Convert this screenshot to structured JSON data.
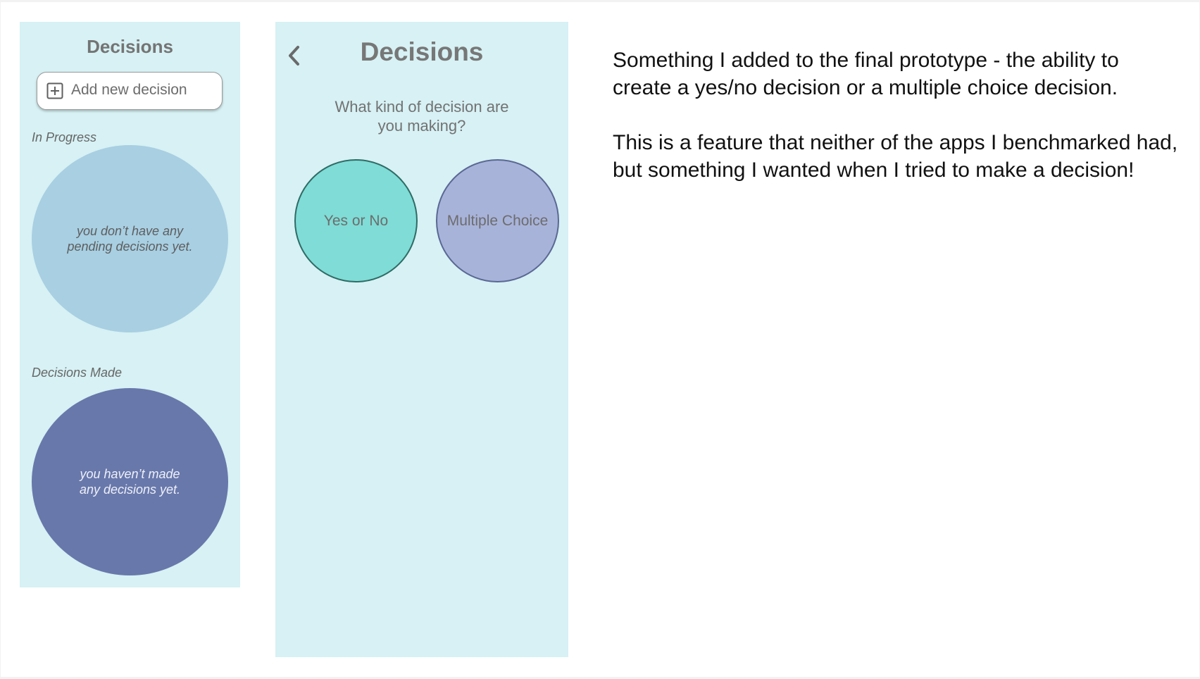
{
  "screen1": {
    "title": "Decisions",
    "add_button_label": "Add new decision",
    "in_progress_label": "In Progress",
    "in_progress_empty": "you don’t have any\npending decisions yet.",
    "made_label": "Decisions Made",
    "made_empty": "you haven’t made\nany decisions yet."
  },
  "screen2": {
    "title": "Decisions",
    "question": "What kind of decision are\nyou making?",
    "option_yes_no": "Yes or No",
    "option_multiple": "Multiple Choice"
  },
  "notes": {
    "paragraph1": "Something I added to the final prototype - the ability to create a yes/no decision or a multiple choice decision.",
    "paragraph2": "This is a feature that neither of the apps I benchmarked had, but something I wanted when I tried to make a decision!"
  },
  "icons": {
    "add": "plus-square-icon",
    "back": "chevron-left-icon"
  },
  "colors": {
    "phone_bg": "#d7f1f4",
    "in_progress_circle": "#a8cfe2",
    "made_circle": "#6878ab",
    "yes_no_circle": "#7fdcd6",
    "multiple_choice_circle": "#a8b3da"
  }
}
